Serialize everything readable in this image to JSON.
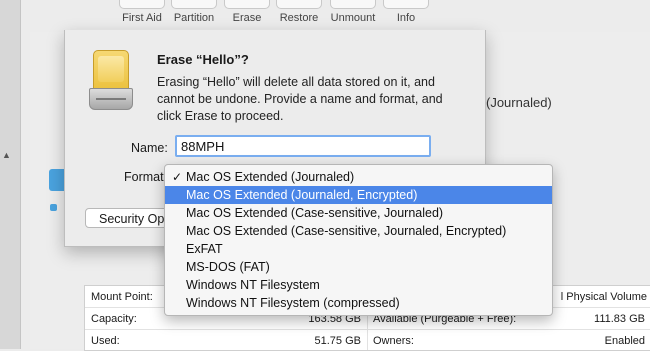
{
  "toolbar": {
    "items": [
      "First Aid",
      "Partition",
      "Erase",
      "Restore",
      "Unmount",
      "Info"
    ]
  },
  "background": {
    "format_text": "(Journaled)",
    "security_button": "Security Op"
  },
  "sheet": {
    "title": "Erase “Hello”?",
    "message": "Erasing “Hello” will delete all data stored on it, and cannot be undone. Provide a name and format, and click Erase to proceed.",
    "name_label": "Name:",
    "name_value": "88MPH",
    "format_label": "Format"
  },
  "format_menu": {
    "checked_index": 0,
    "selected_index": 1,
    "options": [
      "Mac OS Extended (Journaled)",
      "Mac OS Extended (Journaled, Encrypted)",
      "Mac OS Extended (Case-sensitive, Journaled)",
      "Mac OS Extended (Case-sensitive, Journaled, Encrypted)",
      "ExFAT",
      "MS-DOS (FAT)",
      "Windows NT Filesystem",
      "Windows NT Filesystem (compressed)"
    ]
  },
  "info": {
    "mount_point_label": "Mount Point:",
    "type_value": "l Physical Volume",
    "capacity_label": "Capacity:",
    "capacity_value": "163.58 GB",
    "available_label": "Available (Purgeable + Free):",
    "available_value": "111.83 GB",
    "used_label": "Used:",
    "used_value": "51.75 GB",
    "owners_label": "Owners:",
    "owners_value": "Enabled"
  },
  "colors": {
    "selection": "#4b86e8",
    "accent": "#4aa3df"
  }
}
